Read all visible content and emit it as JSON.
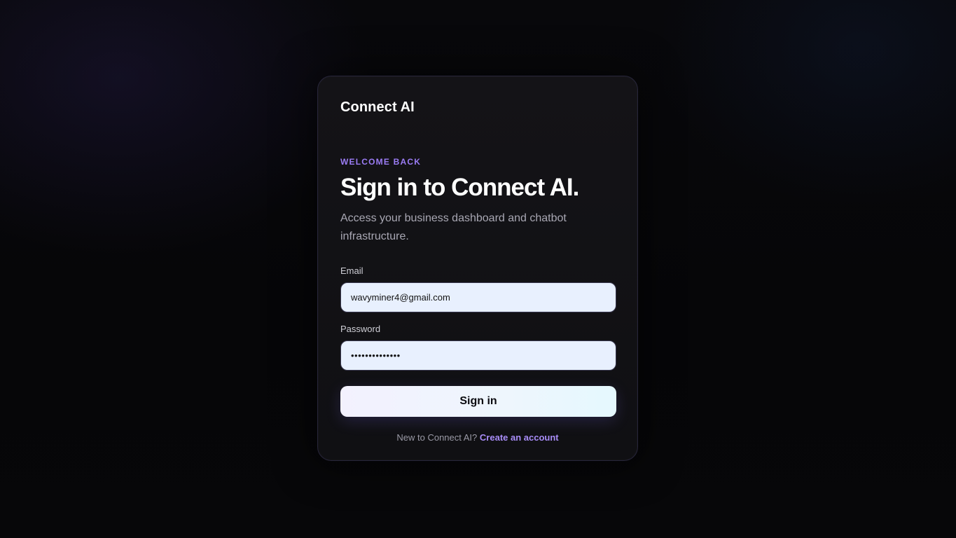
{
  "brand": {
    "name": "Connect AI"
  },
  "header": {
    "eyebrow": "WELCOME BACK",
    "title": "Sign in to Connect AI.",
    "subtitle": "Access your business dashboard and chatbot infrastructure."
  },
  "form": {
    "email": {
      "label": "Email",
      "value": "wavyminer4@gmail.com"
    },
    "password": {
      "label": "Password",
      "value": "••••••••••••••"
    },
    "submit_label": "Sign in"
  },
  "footer": {
    "prompt": "New to Connect AI?",
    "link_label": "Create an account"
  },
  "colors": {
    "accent": "#9b7cf5",
    "link": "#a88cf7",
    "card_background": "#131216",
    "input_background": "#e8f0fe"
  }
}
